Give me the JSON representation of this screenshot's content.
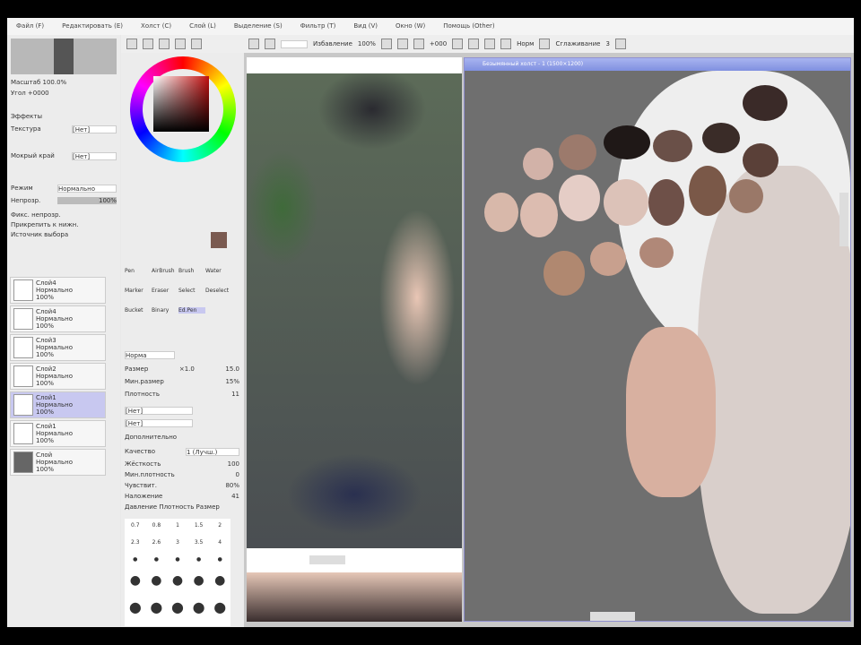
{
  "menu": [
    "Файл (F)",
    "Редактировать (E)",
    "Холст (C)",
    "Слой (L)",
    "Выделение (S)",
    "Фильтр (T)",
    "Вид (V)",
    "Окно (W)",
    "Помощь (Other)"
  ],
  "toolbar": {
    "antialias": "Избавление",
    "zoom": "100%",
    "angle": "+000",
    "mode": "Норм",
    "smoothing_label": "Сглаживание",
    "smoothing_value": "3"
  },
  "navigator": {
    "zoom": "Масштаб 100.0%",
    "angle": "Угол +0000"
  },
  "layer_props": {
    "effect": "Эффекты",
    "texture": "Текстура",
    "texture_val": "[Нет]",
    "effect2": "Мокрый край",
    "effect2_val": "[Нет]",
    "mode_label": "Режим",
    "mode_val": "Нормально",
    "opacity_label": "Непрозр.",
    "opacity_val": "100%",
    "checks": [
      "Фикс. непрозр.",
      "Прикрепить к нижн.",
      "Источник выбора"
    ]
  },
  "layers": [
    {
      "name": "Слой4",
      "mode": "Нормально",
      "opacity": "100%"
    },
    {
      "name": "Слой4",
      "mode": "Нормально",
      "opacity": "100%"
    },
    {
      "name": "Слой3",
      "mode": "Нормально",
      "opacity": "100%"
    },
    {
      "name": "Слой2",
      "mode": "Нормально",
      "opacity": "100%"
    },
    {
      "name": "Слой1",
      "mode": "Нормально",
      "opacity": "100%"
    },
    {
      "name": "Слой1",
      "mode": "Нормально",
      "opacity": "100%"
    },
    {
      "name": "Слой",
      "mode": "Нормально",
      "opacity": "100%"
    }
  ],
  "tools": [
    "Pen",
    "AirBrush",
    "Brush",
    "Water",
    "Marker",
    "Eraser",
    "Select",
    "Deselect",
    "Bucket",
    "Binary",
    "Ed.Pen"
  ],
  "brush": {
    "shape": "Норма",
    "size_label": "Размер",
    "size_val": "×1.0",
    "size2": "15.0",
    "min_label": "Мин.размер",
    "min_val": "15%",
    "density_label": "Плотность",
    "density_val": "11",
    "tex1": "[Нет]",
    "tex2": "[Нет]",
    "advanced": "Дополнительно",
    "quality_label": "Качество",
    "quality_val": "1 (Лучш.)",
    "edge_label": "Жёсткость",
    "edge_val": "100",
    "min_density_label": "Мин.плотность",
    "min_density_val": "0",
    "pressure_label": "Чувствит.",
    "pressure_val": "80%",
    "blend_label": "Наложение",
    "blend_val": "41",
    "bottom": "Давление  Плотность  Размер"
  },
  "brush_sizes": [
    "0.7",
    "0.8",
    "1",
    "1.5",
    "2",
    "2.3",
    "2.6",
    "3",
    "3.5",
    "4"
  ],
  "canvas_title": "Безымянный холст - 1 (1500×1200)",
  "colors": {
    "accent": "#8090e0",
    "skin": "#e9c6b5"
  }
}
